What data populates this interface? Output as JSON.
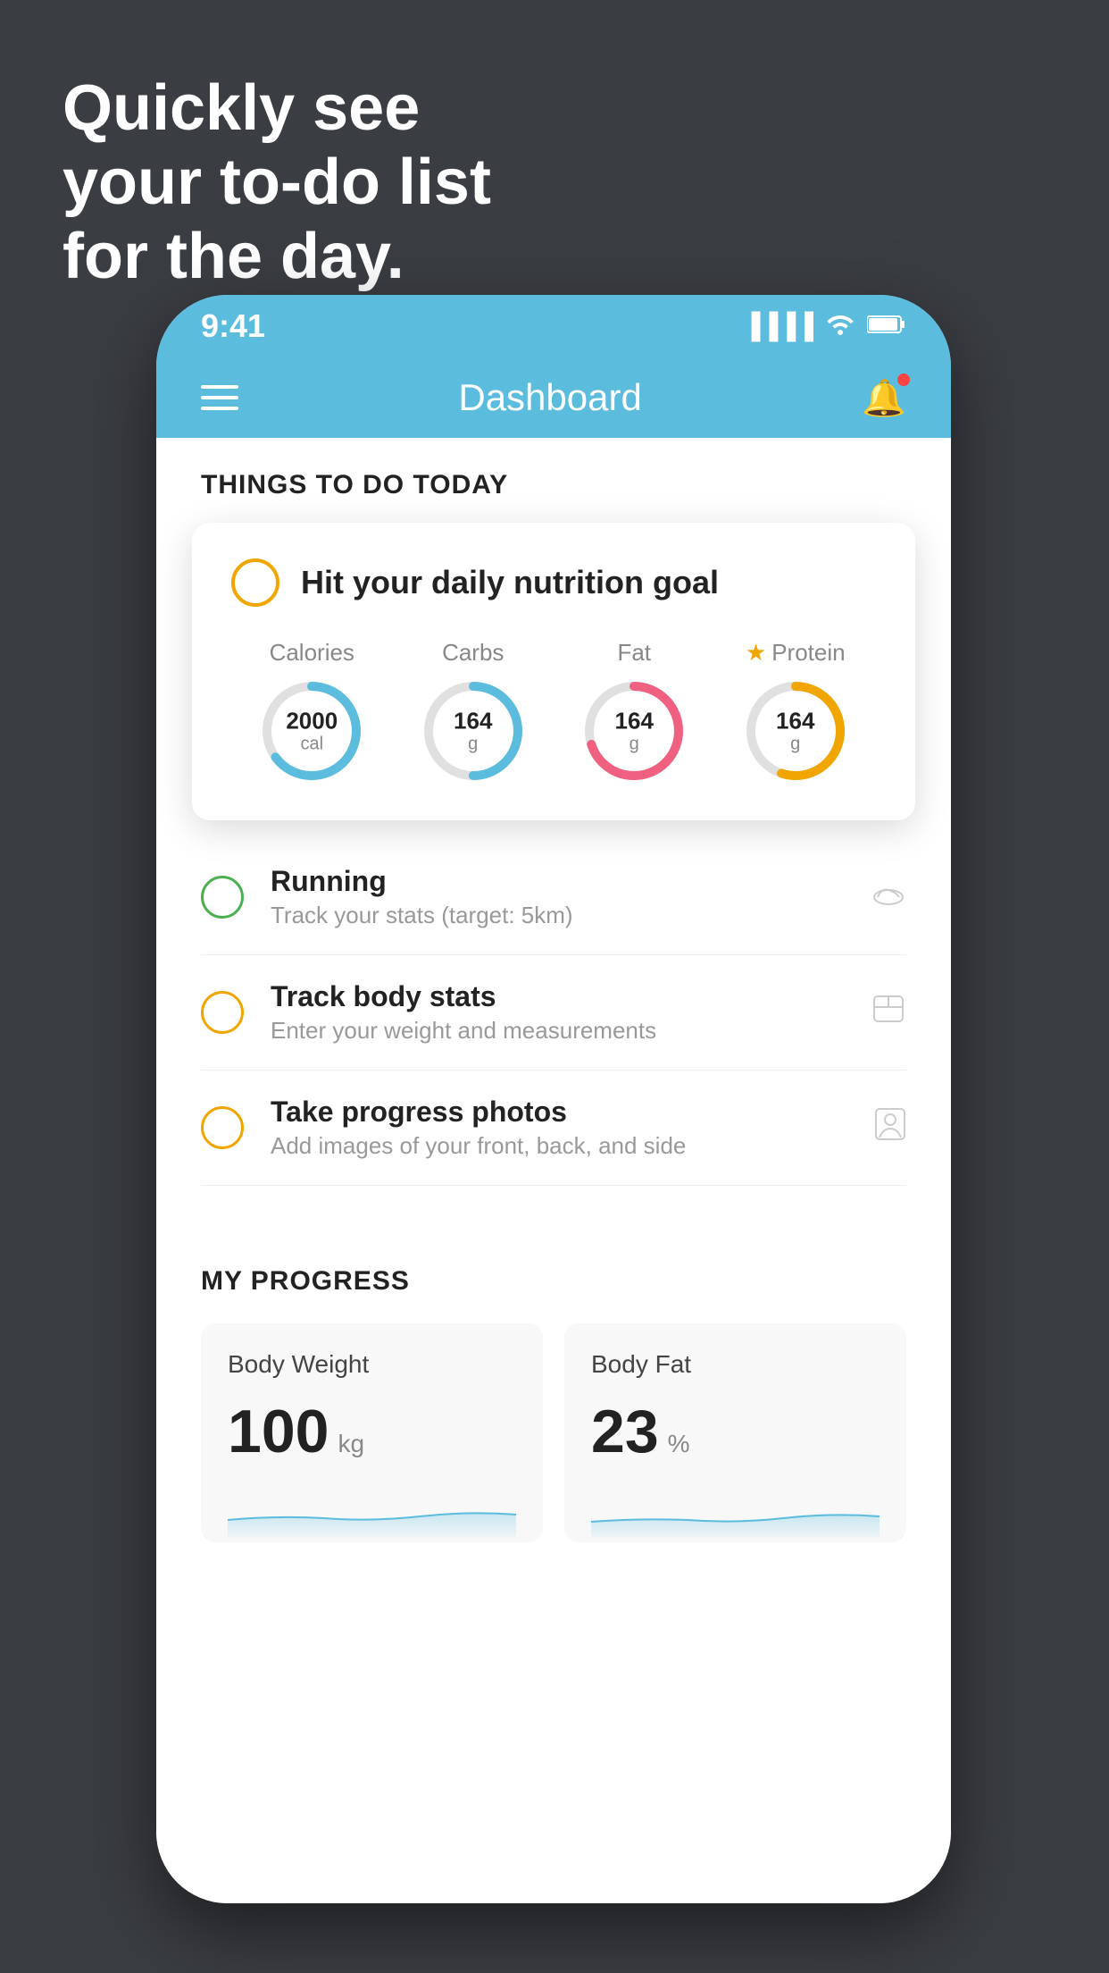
{
  "headline": {
    "line1": "Quickly see",
    "line2": "your to-do list",
    "line3": "for the day."
  },
  "status_bar": {
    "time": "9:41",
    "signal": "▐▐▐▐",
    "wifi": "wifi",
    "battery": "battery"
  },
  "nav": {
    "title": "Dashboard"
  },
  "things_section": {
    "header": "THINGS TO DO TODAY"
  },
  "featured_card": {
    "title": "Hit your daily nutrition goal",
    "nutrition": [
      {
        "label": "Calories",
        "value": "2000",
        "unit": "cal",
        "color": "#5bbcde",
        "track_color": "#e0e0e0",
        "percent": 65,
        "starred": false
      },
      {
        "label": "Carbs",
        "value": "164",
        "unit": "g",
        "color": "#5bbcde",
        "track_color": "#e0e0e0",
        "percent": 50,
        "starred": false
      },
      {
        "label": "Fat",
        "value": "164",
        "unit": "g",
        "color": "#f06080",
        "track_color": "#e0e0e0",
        "percent": 70,
        "starred": false
      },
      {
        "label": "Protein",
        "value": "164",
        "unit": "g",
        "color": "#f0a500",
        "track_color": "#e0e0e0",
        "percent": 55,
        "starred": true
      }
    ]
  },
  "todo_items": [
    {
      "title": "Running",
      "subtitle": "Track your stats (target: 5km)",
      "circle_color": "green",
      "icon": "shoe"
    },
    {
      "title": "Track body stats",
      "subtitle": "Enter your weight and measurements",
      "circle_color": "yellow",
      "icon": "scale"
    },
    {
      "title": "Take progress photos",
      "subtitle": "Add images of your front, back, and side",
      "circle_color": "yellow",
      "icon": "person"
    }
  ],
  "progress_section": {
    "header": "MY PROGRESS",
    "cards": [
      {
        "title": "Body Weight",
        "value": "100",
        "unit": "kg"
      },
      {
        "title": "Body Fat",
        "value": "23",
        "unit": "%"
      }
    ]
  }
}
